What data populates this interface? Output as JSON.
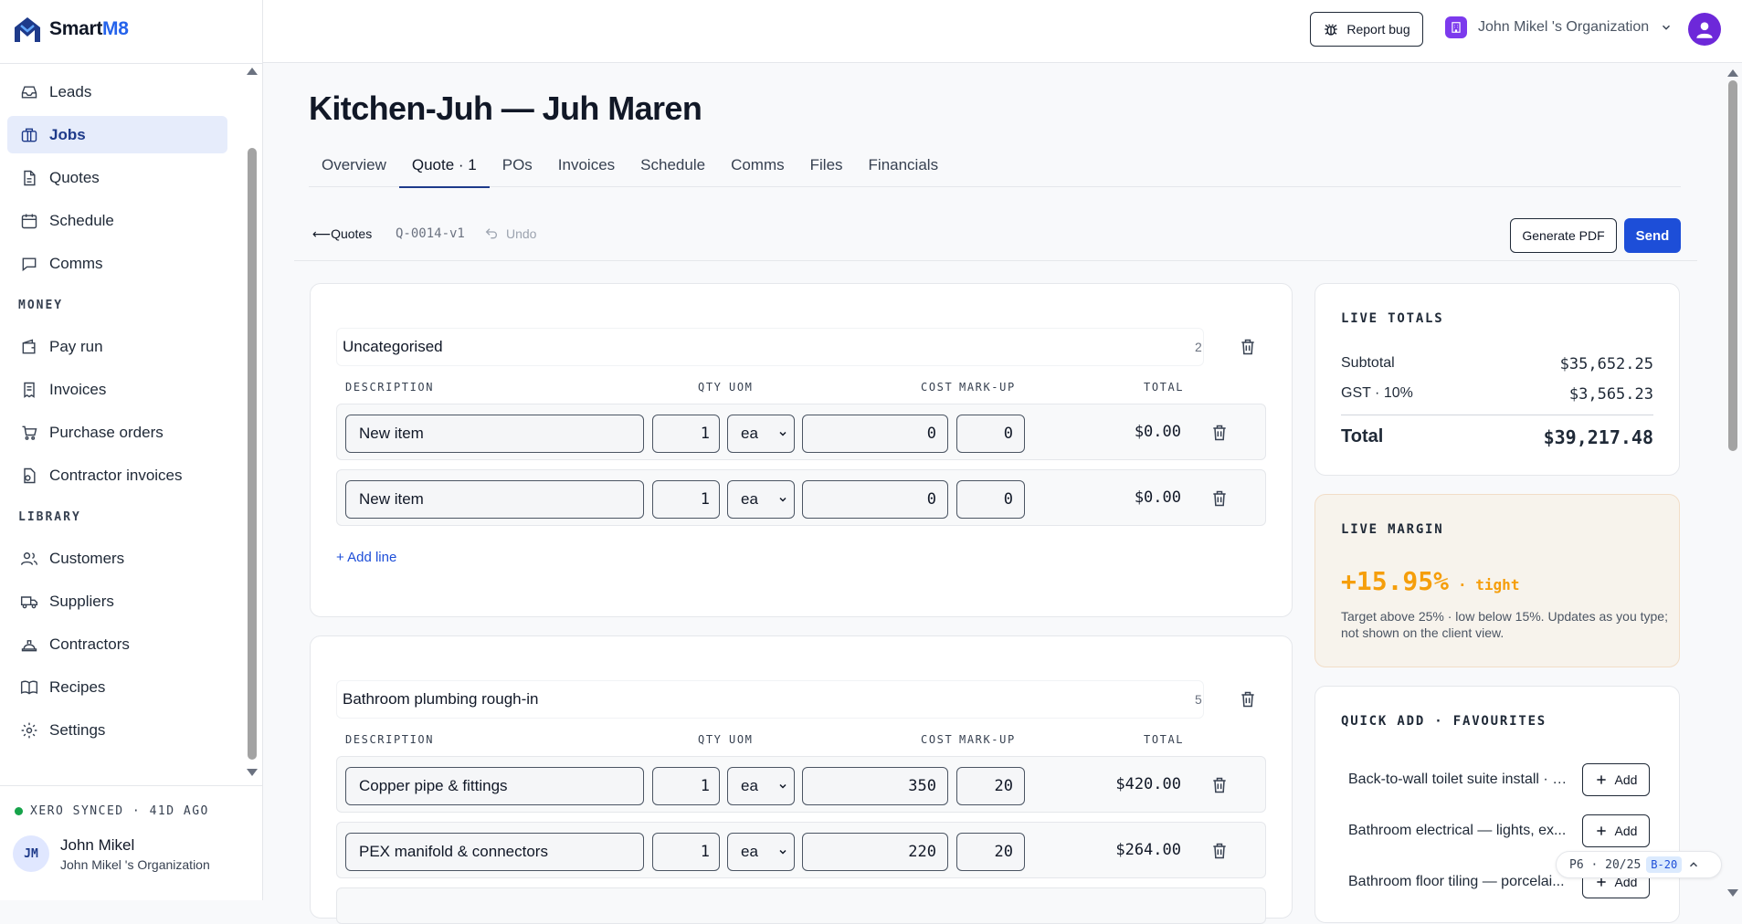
{
  "app": {
    "logo_prefix": "Smart",
    "logo_accent": "M8",
    "brand_color": "#1e3a8a",
    "accent_color": "#2563eb"
  },
  "sidebar": {
    "items_top": [
      {
        "label": "Leads",
        "icon": "inbox-icon"
      },
      {
        "label": "Jobs",
        "icon": "briefcase-icon",
        "active": true
      },
      {
        "label": "Quotes",
        "icon": "document-icon"
      },
      {
        "label": "Schedule",
        "icon": "calendar-icon"
      },
      {
        "label": "Comms",
        "icon": "chat-icon"
      }
    ],
    "money_heading": "MONEY",
    "items_money": [
      {
        "label": "Pay run",
        "icon": "wallet-icon"
      },
      {
        "label": "Invoices",
        "icon": "receipt-icon"
      },
      {
        "label": "Purchase orders",
        "icon": "cart-icon"
      },
      {
        "label": "Contractor invoices",
        "icon": "contractor-invoice-icon"
      }
    ],
    "library_heading": "LIBRARY",
    "items_library": [
      {
        "label": "Customers",
        "icon": "users-icon"
      },
      {
        "label": "Suppliers",
        "icon": "truck-icon"
      },
      {
        "label": "Contractors",
        "icon": "hardhat-icon"
      },
      {
        "label": "Recipes",
        "icon": "book-icon"
      },
      {
        "label": "Settings",
        "icon": "gear-icon"
      }
    ],
    "xero_status": "XERO SYNCED · 41D AGO",
    "user_initials": "JM",
    "user_name": "John Mikel",
    "user_org": "John Mikel 's Organization"
  },
  "topbar": {
    "report_bug": "Report bug",
    "org_name": "John Mikel 's Organization"
  },
  "page": {
    "title": "Kitchen-Juh — Juh Maren",
    "tabs": [
      "Overview",
      "Quote · 1",
      "POs",
      "Invoices",
      "Schedule",
      "Comms",
      "Files",
      "Financials"
    ],
    "active_tab": "Quote · 1"
  },
  "quote_bar": {
    "back": "⟵Quotes",
    "quote_id": "Q-0014-v1",
    "undo": "Undo",
    "generate_pdf": "Generate PDF",
    "send": "Send"
  },
  "columns": {
    "description": "DESCRIPTION",
    "qty": "QTY",
    "uom": "UOM",
    "cost": "COST",
    "markup": "MARK-UP",
    "total": "TOTAL"
  },
  "sections": [
    {
      "name": "Uncategorised",
      "count": "2",
      "lines": [
        {
          "description": "New item",
          "qty": "1",
          "uom": "ea",
          "cost": "0",
          "markup": "0",
          "total": "$0.00"
        },
        {
          "description": "New item",
          "qty": "1",
          "uom": "ea",
          "cost": "0",
          "markup": "0",
          "total": "$0.00"
        }
      ],
      "add_line": "+ Add line"
    },
    {
      "name": "Bathroom plumbing rough-in",
      "count": "5",
      "lines": [
        {
          "description": "Copper pipe & fittings",
          "qty": "1",
          "uom": "ea",
          "cost": "350",
          "markup": "20",
          "total": "$420.00"
        },
        {
          "description": "PEX manifold & connectors",
          "qty": "1",
          "uom": "ea",
          "cost": "220",
          "markup": "20",
          "total": "$264.00"
        }
      ]
    }
  ],
  "live_totals": {
    "title": "LIVE TOTALS",
    "subtotal_label": "Subtotal",
    "subtotal": "$35,652.25",
    "gst_label": "GST · 10%",
    "gst": "$3,565.23",
    "total_label": "Total",
    "total": "$39,217.48"
  },
  "live_margin": {
    "title": "LIVE MARGIN",
    "value": "+15.95%",
    "status": "· tight",
    "note": "Target above 25% · low below 15%. Updates as you type; not shown on the client view.",
    "color": "#f59e0b"
  },
  "favourites": {
    "title": "QUICK ADD · FAVOURITES",
    "add_label": "Add",
    "items": [
      "Back-to-wall toilet suite install · 1...",
      "Bathroom electrical — lights, ex...",
      "Bathroom floor tiling — porcelai..."
    ]
  },
  "pager": {
    "text": "P6 · 20/25",
    "tag": "B-20"
  }
}
